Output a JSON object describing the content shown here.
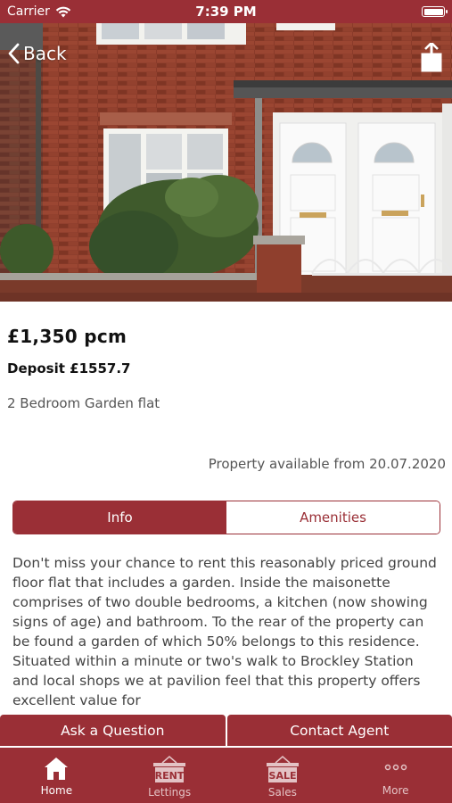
{
  "status_bar": {
    "carrier": "Carrier",
    "time": "7:39 PM"
  },
  "nav": {
    "back_label": "Back"
  },
  "listing": {
    "price": "£1,350 pcm",
    "deposit": "Deposit £1557.7",
    "title": "2 Bedroom Garden flat",
    "availability": "Property available from 20.07.2020"
  },
  "tabs_segment": {
    "info_label": "Info",
    "amenities_label": "Amenities",
    "selected": "Info"
  },
  "description": "Don't miss your chance to rent this reasonably priced ground floor flat that includes a garden. Inside the maisonette comprises of two double bedrooms, a kitchen (now showing signs of age) and bathroom. To the rear of the property can be found a garden of which 50% belongs to this residence. Situated within a minute or two's walk to Brockley Station and local shops we at pavilion feel that this property offers excellent value for",
  "actions": {
    "ask_label": "Ask a Question",
    "contact_label": "Contact Agent"
  },
  "tab_bar": {
    "items": [
      {
        "label": "Home",
        "icon": "house-icon",
        "active": true
      },
      {
        "label": "Lettings",
        "icon": "rent-sign-icon",
        "sign_text": "RENT",
        "active": false
      },
      {
        "label": "Sales",
        "icon": "sale-sign-icon",
        "sign_text": "SALE",
        "active": false
      },
      {
        "label": "More",
        "icon": "more-dots-icon",
        "active": false
      }
    ]
  },
  "colors": {
    "brand": "#9a2f36",
    "white": "#ffffff"
  }
}
